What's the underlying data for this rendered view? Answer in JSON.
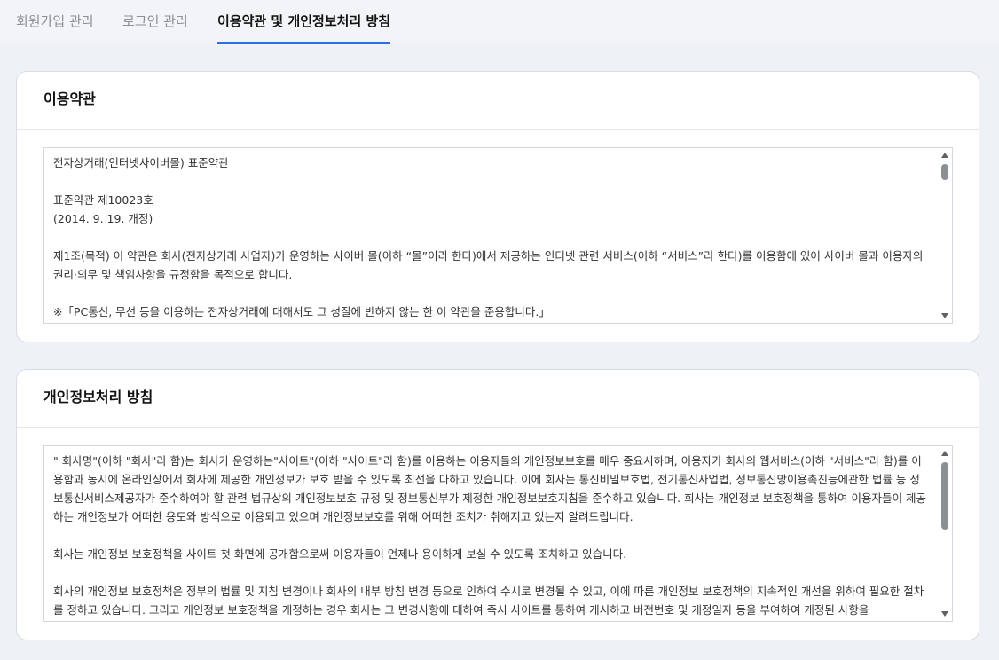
{
  "tabs": [
    {
      "label": "회원가입 관리",
      "active": false
    },
    {
      "label": "로그인 관리",
      "active": false
    },
    {
      "label": "이용약관 및 개인정보처리 방침",
      "active": true
    }
  ],
  "terms": {
    "title": "이용약관",
    "paragraphs": [
      "전자상거래(인터넷사이버몰) 표준약관",
      "",
      "표준약관 제10023호\n(2014. 9. 19. 개정)",
      "",
      "제1조(목적) 이 약관은 회사(전자상거래 사업자)가 운영하는 사이버 몰(이하 “몰”이라 한다)에서 제공하는 인터넷 관련 서비스(이하 “서비스”라 한다)를 이용함에 있어 사이버 몰과 이용자의 권리·의무 및 책임사항을 규정함을 목적으로 합니다.",
      "",
      "※「PC통신, 무선 등을 이용하는 전자상거래에 대해서도 그 성질에 반하지 않는 한 이 약관을 준용합니다.」"
    ]
  },
  "privacy": {
    "title": "개인정보처리 방침",
    "paragraphs": [
      "\" 회사명\"(이하 \"회사\"라 함)는 회사가 운영하는\"사이트\"(이하 \"사이트\"라 함)를 이용하는 이용자들의 개인정보보호를 매우 중요시하며, 이용자가 회사의 웹서비스(이하 \"서비스\"라 함)를 이용함과 동시에 온라인상에서 회사에 제공한 개인정보가 보호 받을 수 있도록 최선을 다하고 있습니다. 이에 회사는 통신비밀보호법, 전기통신사업법, 정보통신망이용촉진등에관한 법률 등 정보통신서비스제공자가 준수하여야 할 관련 법규상의 개인정보보호 규정 및 정보통신부가 제정한 개인정보보호지침을 준수하고 있습니다. 회사는 개인정보 보호정책을 통하여 이용자들이 제공하는 개인정보가 어떠한 용도와 방식으로 이용되고 있으며 개인정보보호를 위해 어떠한 조치가 취해지고 있는지 알려드립니다.",
      "",
      "회사는 개인정보 보호정책을 사이트 첫 화면에 공개함으로써 이용자들이 언제나 용이하게 보실 수 있도록 조치하고 있습니다.",
      "",
      "회사의 개인정보 보호정책은 정부의 법률 및 지침 변경이나 회사의 내부 방침 변경 등으로 인하여 수시로 변경될 수 있고, 이에 따른 개인정보 보호정책의 지속적인 개선을 위하여 필요한 절차를 정하고 있습니다. 그리고 개인정보 보호정책을 개정하는 경우 회사는 그 변경사항에 대하여 즉시 사이트를 통하여 게시하고 버전번호 및 개정일자 등을 부여하여 개정된 사항을"
    ]
  }
}
